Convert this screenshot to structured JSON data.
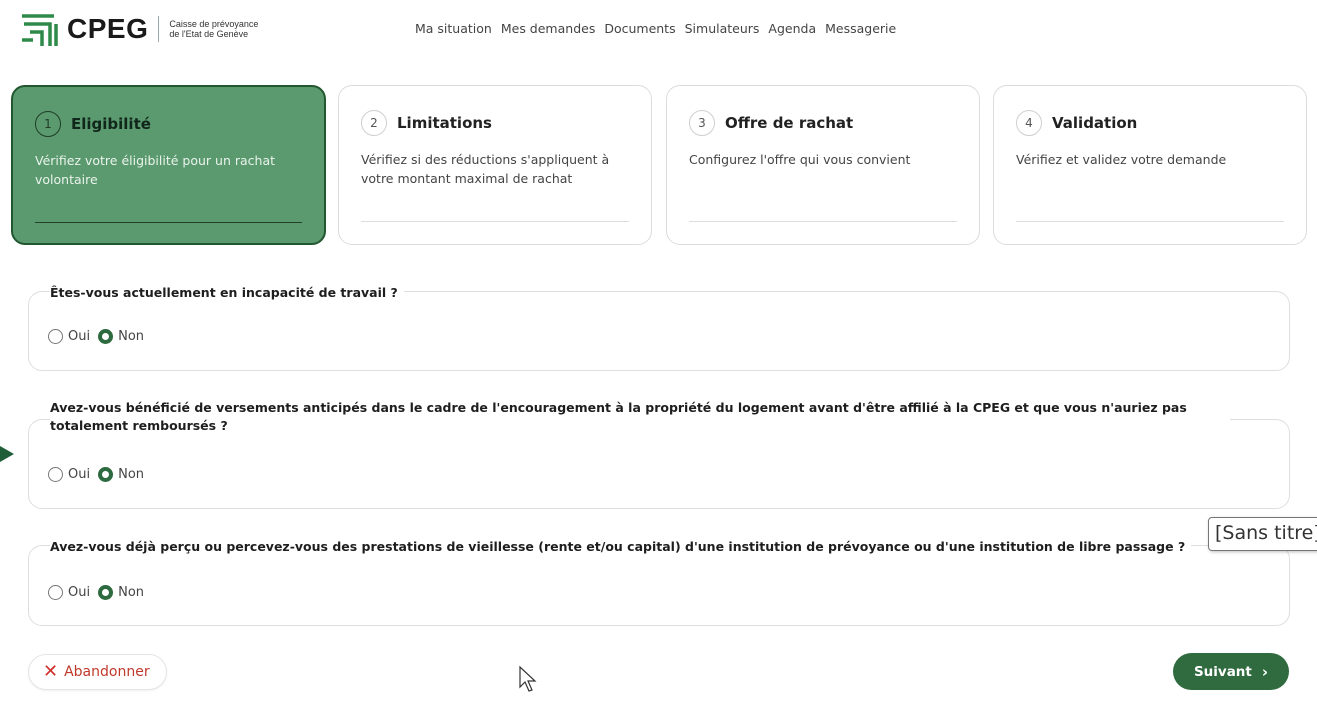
{
  "brand": {
    "name": "CPEG",
    "subtitle_line1": "Caisse de prévoyance",
    "subtitle_line2": "de l'Etat de Genève",
    "accent": "#2f6b3f"
  },
  "nav": {
    "items": [
      "Ma situation",
      "Mes demandes",
      "Documents",
      "Simulateurs",
      "Agenda",
      "Messagerie"
    ]
  },
  "steps": [
    {
      "num": "1",
      "title": "Eligibilité",
      "desc": "Vérifiez votre éligibilité pour un rachat volontaire",
      "active": true
    },
    {
      "num": "2",
      "title": "Limitations",
      "desc": "Vérifiez si des réductions s'appliquent à votre montant maximal de rachat",
      "active": false
    },
    {
      "num": "3",
      "title": "Offre de rachat",
      "desc": "Configurez l'offre qui vous convient",
      "active": false
    },
    {
      "num": "4",
      "title": "Validation",
      "desc": "Vérifiez et validez votre demande",
      "active": false
    }
  ],
  "questions": [
    {
      "label": "Êtes-vous actuellement en incapacité de travail ?",
      "option_yes": "Oui",
      "option_no": "Non",
      "selected": "Non"
    },
    {
      "label": "Avez-vous bénéficié de versements anticipés dans le cadre de l'encouragement à la propriété du logement avant d'être affilié à la CPEG et que vous n'auriez pas totalement remboursés ?",
      "option_yes": "Oui",
      "option_no": "Non",
      "selected": "Non"
    },
    {
      "label": "Avez-vous déjà perçu ou percevez-vous des prestations de vieillesse (rente et/ou capital) d'une institution de prévoyance ou d'une institution de libre passage ?",
      "option_yes": "Oui",
      "option_no": "Non",
      "selected": "Non"
    }
  ],
  "actions": {
    "cancel_label": "Abandonner",
    "cancel_icon": "close-icon",
    "next_label": "Suivant",
    "next_icon": "chevron-right-icon"
  },
  "tooltip": {
    "text": "[Sans titre]"
  }
}
